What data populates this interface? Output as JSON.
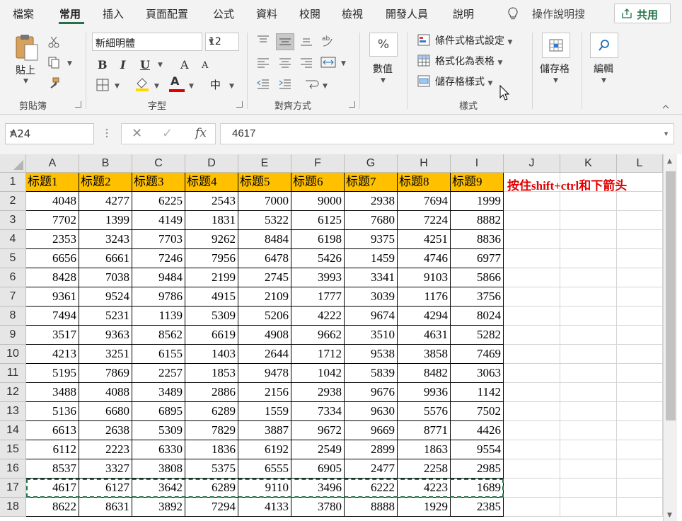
{
  "menu": {
    "tabs": [
      "檔案",
      "常用",
      "插入",
      "頁面配置",
      "公式",
      "資料",
      "校閱",
      "檢視",
      "開發人員",
      "說明"
    ],
    "active_tab": "常用",
    "tell_me": "操作說明搜",
    "share": "共用"
  },
  "ribbon": {
    "clipboard": {
      "paste": "貼上",
      "group": "剪貼簿"
    },
    "font": {
      "name": "新細明體",
      "size": "12",
      "bold": "B",
      "italic": "I",
      "underline": "U",
      "grow": "A",
      "shrink": "A",
      "font_color_letter": "A",
      "phonetic": "中",
      "group": "字型"
    },
    "alignment": {
      "group": "對齊方式"
    },
    "number": {
      "symbol": "%",
      "label": "數值"
    },
    "styles": {
      "conditional": "條件式格式設定",
      "table": "格式化為表格",
      "cell_styles": "儲存格樣式",
      "group": "樣式"
    },
    "cells": {
      "label": "儲存格"
    },
    "editing": {
      "label": "編輯"
    }
  },
  "formula_bar": {
    "name_box": "A24",
    "cancel": "✕",
    "enter": "✓",
    "fx": "fx",
    "value": "4617"
  },
  "sheet": {
    "columns": [
      "A",
      "B",
      "C",
      "D",
      "E",
      "F",
      "G",
      "H",
      "I",
      "J",
      "K",
      "L"
    ],
    "rows": [
      "1",
      "2",
      "3",
      "4",
      "5",
      "6",
      "7",
      "8",
      "9",
      "10",
      "11",
      "12",
      "13",
      "14",
      "15",
      "16",
      "17",
      "18"
    ],
    "headers": [
      "标题1",
      "标题2",
      "标题3",
      "标题4",
      "标题5",
      "标题6",
      "标题7",
      "标题8",
      "标题9"
    ],
    "data": [
      [
        "4048",
        "4277",
        "6225",
        "2543",
        "7000",
        "9000",
        "2938",
        "7694",
        "1999"
      ],
      [
        "7702",
        "1399",
        "4149",
        "1831",
        "5322",
        "6125",
        "7680",
        "7224",
        "8882"
      ],
      [
        "2353",
        "3243",
        "7703",
        "9262",
        "8484",
        "6198",
        "9375",
        "4251",
        "8836"
      ],
      [
        "6656",
        "6661",
        "7246",
        "7956",
        "6478",
        "5426",
        "1459",
        "4746",
        "6977"
      ],
      [
        "8428",
        "7038",
        "9484",
        "2199",
        "2745",
        "3993",
        "3341",
        "9103",
        "5866"
      ],
      [
        "9361",
        "9524",
        "9786",
        "4915",
        "2109",
        "1777",
        "3039",
        "1176",
        "3756"
      ],
      [
        "7494",
        "5231",
        "1139",
        "5309",
        "5206",
        "4222",
        "9674",
        "4294",
        "8024"
      ],
      [
        "3517",
        "9363",
        "8562",
        "6619",
        "4908",
        "9662",
        "3510",
        "4631",
        "5282"
      ],
      [
        "4213",
        "3251",
        "6155",
        "1403",
        "2644",
        "1712",
        "9538",
        "3858",
        "7469"
      ],
      [
        "5195",
        "7869",
        "2257",
        "1853",
        "9478",
        "1042",
        "5839",
        "8482",
        "3063"
      ],
      [
        "3488",
        "4088",
        "3489",
        "2886",
        "2156",
        "2938",
        "9676",
        "9936",
        "1142"
      ],
      [
        "5136",
        "6680",
        "6895",
        "6289",
        "1559",
        "7334",
        "9630",
        "5576",
        "7502"
      ],
      [
        "6613",
        "2638",
        "5309",
        "7829",
        "3887",
        "9672",
        "9669",
        "8771",
        "4426"
      ],
      [
        "6112",
        "2223",
        "6330",
        "1836",
        "6192",
        "2549",
        "2899",
        "1863",
        "9554"
      ],
      [
        "8537",
        "3327",
        "3808",
        "5375",
        "6555",
        "6905",
        "2477",
        "2258",
        "2985"
      ],
      [
        "4617",
        "6127",
        "3642",
        "6289",
        "9110",
        "3496",
        "6222",
        "4223",
        "1689"
      ],
      [
        "8622",
        "8631",
        "3892",
        "7294",
        "4133",
        "3780",
        "8888",
        "1929",
        "2385"
      ]
    ],
    "note": "按住shift+ctrl和下箭头"
  },
  "colors": {
    "accent": "#217346",
    "header_fill": "#ffc000",
    "note": "#e00000"
  }
}
